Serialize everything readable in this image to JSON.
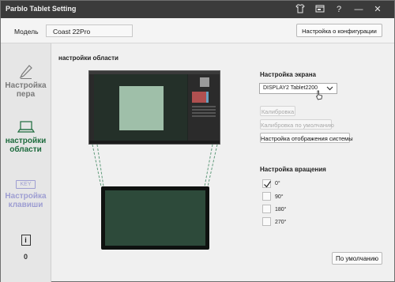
{
  "app": {
    "title": "Parblo Tablet Setting"
  },
  "titlebar": {
    "icons": [
      "shirt-icon",
      "window-icon",
      "help-icon",
      "minimize-icon",
      "close-icon"
    ],
    "help_glyph": "?",
    "minimize_glyph": "—",
    "close_glyph": "✕"
  },
  "model": {
    "label": "Модель",
    "value": "Coast 22Pro",
    "config_button": "Настройка о конфигурации"
  },
  "sidebar": {
    "items": [
      {
        "label_line1": "Настройка",
        "label_line2": "пера",
        "icon": "pen-icon",
        "state": "inactive"
      },
      {
        "label_line1": "настройки",
        "label_line2": "области",
        "icon": "laptop-icon",
        "state": "active"
      },
      {
        "label_line1": "Настройка",
        "label_line2": "клавиши",
        "icon": "key-icon",
        "badge": "KEY",
        "state": "disabled"
      }
    ],
    "info": {
      "icon": "info-icon",
      "glyph": "i",
      "number": "0"
    }
  },
  "area": {
    "title": "настройки области"
  },
  "screen_settings": {
    "title": "Настройка экрана",
    "display_select": "DISPLAY2 Tablet2200",
    "calibrate": "Калибровка",
    "calibrate_default": "Калибровка по умолчанию",
    "system_display": "Настройка отображения системы"
  },
  "rotation": {
    "title": "Настройка вращения",
    "options": [
      {
        "label": "0°",
        "checked": true
      },
      {
        "label": "90°",
        "checked": false
      },
      {
        "label": "180°",
        "checked": false
      },
      {
        "label": "270°",
        "checked": false
      }
    ]
  },
  "default_button": "По умолчанию",
  "colors": {
    "titlebar": "#3b3b3b",
    "active_green": "#1d6b3d",
    "screen_green": "#2d4a3a",
    "mapped_area": "#9fbfa9",
    "key_purple": "#9e9ed2"
  }
}
